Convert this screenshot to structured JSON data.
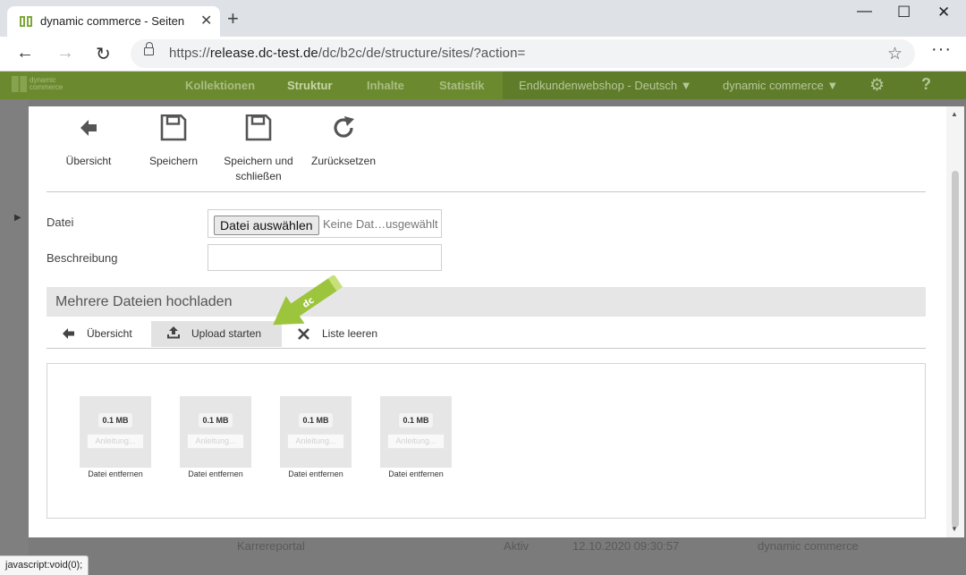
{
  "browser": {
    "tab_title": "dynamic commerce - Seiten",
    "tab_close": "✕",
    "new_tab": "+",
    "url_prefix": "https://",
    "url_host": "release.dc-test.de",
    "url_path": "/dc/b2c/de/structure/sites/?action=",
    "status_text": "javascript:void(0);"
  },
  "app": {
    "logo_text_1": "dynamic",
    "logo_text_2": "commerce",
    "nav": [
      "Kollektionen",
      "Struktur",
      "Inhalte",
      "Statistik"
    ],
    "shop_selector": "Endkundenwebshop - Deutsch",
    "company_selector": "dynamic commerce",
    "accent_color": "#6b8a2f"
  },
  "toolbar": {
    "overview": "Übersicht",
    "save": "Speichern",
    "save_close_1": "Speichern und",
    "save_close_2": "schließen",
    "reset": "Zurücksetzen"
  },
  "form": {
    "file_label": "Datei",
    "file_button": "Datei auswählen",
    "file_none": "Keine Dat…usgewählt",
    "description_label": "Beschreibung",
    "description_value": ""
  },
  "multi_upload": {
    "title": "Mehrere Dateien hochladen",
    "overview": "Übersicht",
    "start": "Upload starten",
    "clear": "Liste leeren",
    "files": [
      {
        "size": "0.1 MB",
        "placeholder": "Anleitung...",
        "remove": "Datei entfernen"
      },
      {
        "size": "0.1 MB",
        "placeholder": "Anleitung...",
        "remove": "Datei entfernen"
      },
      {
        "size": "0.1 MB",
        "placeholder": "Anleitung...",
        "remove": "Datei entfernen"
      },
      {
        "size": "0.1 MB",
        "placeholder": "Anleitung...",
        "remove": "Datei entfernen"
      }
    ]
  },
  "background_row": {
    "name": "Karrereportal",
    "status": "Aktiv",
    "date": "12.10.2020 09:30:57",
    "owner": "dynamic commerce"
  }
}
